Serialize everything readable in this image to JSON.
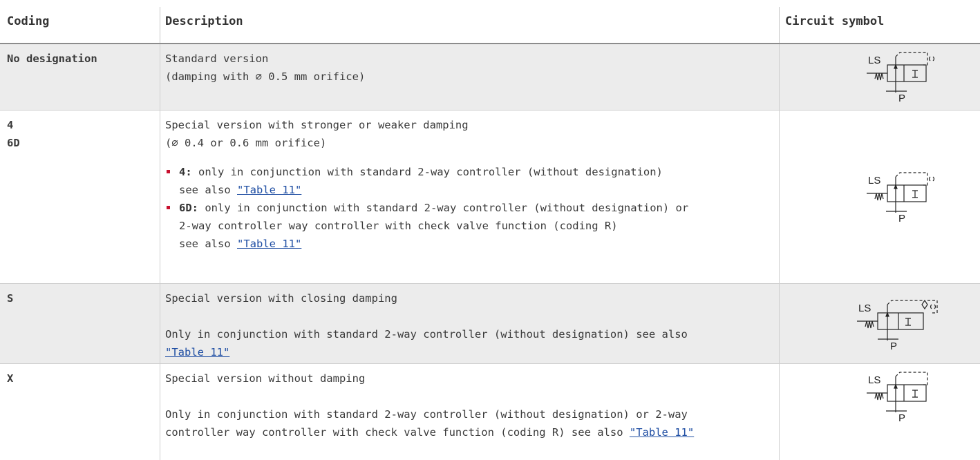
{
  "header": {
    "coding": "Coding",
    "description": "Description",
    "circuit_symbol": "Circuit symbol"
  },
  "rows": [
    {
      "coding": "No designation",
      "desc_line1": "Standard version",
      "desc_line2": "(damping with ∅ 0.5 mm orifice)",
      "symbol": {
        "ls": "LS",
        "p": "P",
        "variant": "orifice"
      }
    },
    {
      "coding_line1": "4",
      "coding_line2": "6D",
      "desc_line1": "Special version with stronger or weaker damping",
      "desc_line2": "(∅ 0.4 or 0.6 mm orifice)",
      "bullets": [
        {
          "key": "4:",
          "text": " only in conjunction with standard 2-way controller (without designation)",
          "line2": "see also ",
          "link": "\"Table 11\""
        },
        {
          "key": "6D:",
          "text": " only in conjunction with standard 2-way controller (without designation) or",
          "line2": "2-way controller way controller with check valve function (coding R)",
          "line3": "see also ",
          "link": "\"Table 11\""
        }
      ],
      "symbol": {
        "ls": "LS",
        "p": "P",
        "variant": "orifice"
      }
    },
    {
      "coding": "S",
      "desc_line1": "Special version with closing damping",
      "desc_line2": "Only in conjunction with standard 2-way controller (without designation) see also",
      "link": "\"Table 11\"",
      "symbol": {
        "ls": "LS",
        "p": "P",
        "variant": "check-orifice"
      }
    },
    {
      "coding": "X",
      "desc_line1": "Special version without damping",
      "desc_line2": "Only in conjunction with standard 2-way controller (without designation) or 2-way",
      "desc_line3": "controller way controller with check valve function (coding R) see also ",
      "link": "\"Table 11\"",
      "symbol": {
        "ls": "LS",
        "p": "P",
        "variant": "none"
      }
    }
  ],
  "colors": {
    "header_border": "#8c8c8c",
    "row_grey": "#ececec",
    "link": "#1f4ea3",
    "bullet": "#c8102e"
  }
}
